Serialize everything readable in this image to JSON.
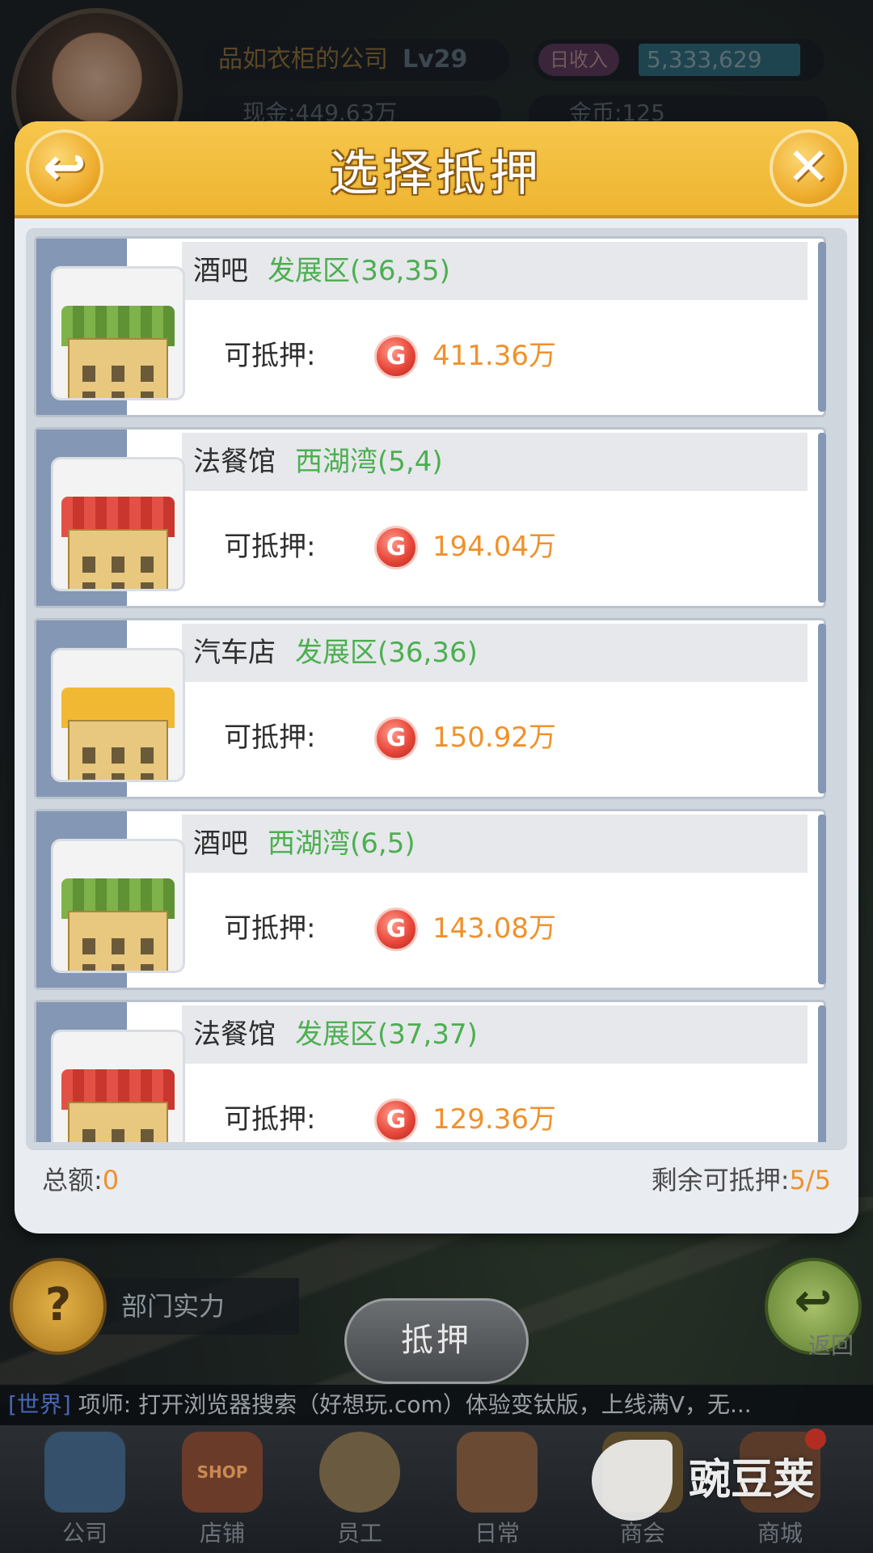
{
  "hud": {
    "company_name": "品如衣柜的公司",
    "level": "Lv29",
    "income_label": "日收入",
    "income_value": "5,333,629",
    "cash_label": "现金:449.63万",
    "coin_label": "金币:125"
  },
  "modal": {
    "title": "选择抵押",
    "back_icon": "↩",
    "close_icon": "✕",
    "mortgage_label": "可抵押:",
    "coin_symbol": "G",
    "items": [
      {
        "name": "酒吧",
        "location": "发展区(36,35)",
        "amount": "411.36万",
        "building": "bar"
      },
      {
        "name": "法餐馆",
        "location": "西湖湾(5,4)",
        "amount": "194.04万",
        "building": "restaurant"
      },
      {
        "name": "汽车店",
        "location": "发展区(36,36)",
        "amount": "150.92万",
        "building": "car"
      },
      {
        "name": "酒吧",
        "location": "西湖湾(6,5)",
        "amount": "143.08万",
        "building": "bar"
      },
      {
        "name": "法餐馆",
        "location": "发展区(37,37)",
        "amount": "129.36万",
        "building": "restaurant"
      }
    ],
    "total_label": "总额:",
    "total_value": "0",
    "remain_label": "剩余可抵押:",
    "remain_value": "5/5"
  },
  "bottom": {
    "dept_label": "部门实力",
    "dept_icon": "?",
    "return_label": "返回",
    "mortgage_button": "抵押",
    "chat_channel": "[世界]",
    "chat_text": "项师: 打开浏览器搜索（好想玩.com）体验变钛版，上线满V，无..."
  },
  "tabs": [
    {
      "label": "公司",
      "icon": "company-icon"
    },
    {
      "label": "店铺",
      "icon": "shop-icon",
      "icon_text": "SHOP"
    },
    {
      "label": "员工",
      "icon": "staff-icon"
    },
    {
      "label": "日常",
      "icon": "daily-icon"
    },
    {
      "label": "商会",
      "icon": "guild-icon"
    },
    {
      "label": "商城",
      "icon": "mall-icon"
    }
  ],
  "watermark": "豌豆荚",
  "colors": {
    "header": "#f0b935",
    "location": "#4caf50",
    "amount": "#f0912b",
    "side_strip": "#8497b4"
  }
}
